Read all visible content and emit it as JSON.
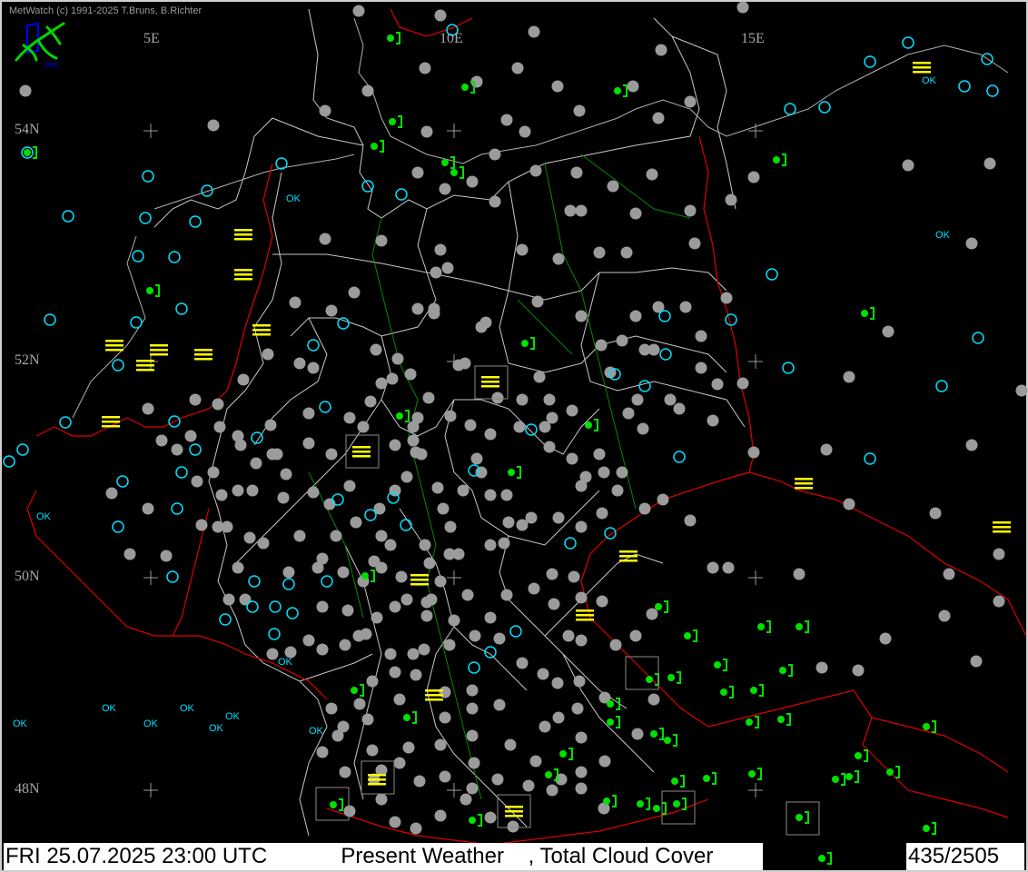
{
  "copyright": "MetWatch  (c) 1991-2025 T.Bruns, B.Richter",
  "logo": {
    "name": "metwatch-frog-logo",
    "color_primary": "#00d800",
    "color_secondary": "#0000ff"
  },
  "longitude_labels": [
    "5E",
    "10E",
    "15E"
  ],
  "latitude_labels": [
    "54N",
    "52N",
    "50N",
    "48N"
  ],
  "footer": {
    "datetime": "FRI 25.07.2025 23:00 UTC",
    "product": "  Present Weather    , Total Cloud Cover",
    "count": "435/2505"
  },
  "station_labels": {
    "ok": "OK"
  },
  "colors": {
    "background": "#000000",
    "border_national": "#e00000",
    "border_regional": "#c8c8c8",
    "rivers": "#009000",
    "cloud_cover_grey": "#9b9b9b",
    "cloud_cover_cyan": "#00e0ff",
    "rain_green": "#00e000",
    "fog_yellow": "#ffff00"
  },
  "legend_symbols": [
    "filled-circle-overcast",
    "half-circle-partly-cloudy",
    "open-circle-clear",
    "fog-lines",
    "rain-dot",
    "shower-triangle",
    "thunderstorm-bracket",
    "drizzle-comma"
  ]
}
